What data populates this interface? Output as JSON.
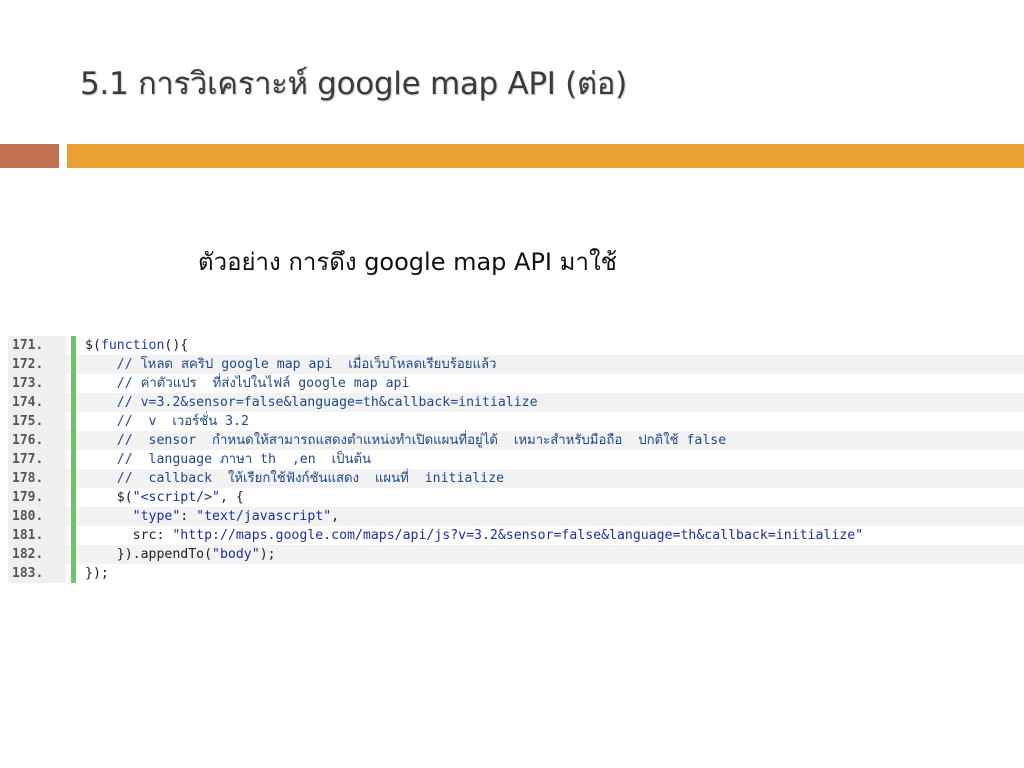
{
  "slide": {
    "title": "5.1 การวิเคราะห์ google map API (ต่อ)",
    "subtitle": "ตัวอย่าง การดึง google map API มาใช้"
  },
  "colors": {
    "title_text": "#3b3b3b",
    "band_left": "#c0704e",
    "band_right": "#eba032",
    "gutter_bar": "#6dc46d",
    "code_comment": "#1f4a8a",
    "code_keyword": "#1a3fa8",
    "code_string": "#1b2f9e"
  },
  "code": {
    "lines": [
      {
        "num": "171.",
        "parts": [
          {
            "t": "$(",
            "k": "plain"
          },
          {
            "t": "function",
            "k": "keyword"
          },
          {
            "t": "(){",
            "k": "plain"
          }
        ]
      },
      {
        "num": "172.",
        "parts": [
          {
            "t": "    // โหลด สคริป google map api  เมื่อเว็บโหลดเรียบร้อยแล้ว",
            "k": "comment"
          }
        ]
      },
      {
        "num": "173.",
        "parts": [
          {
            "t": "    // ค่าตัวแปร  ที่ส่งไปในไฟล์ google map api",
            "k": "comment"
          }
        ]
      },
      {
        "num": "174.",
        "parts": [
          {
            "t": "    // v=3.2&sensor=false&language=th&callback=initialize",
            "k": "comment"
          }
        ]
      },
      {
        "num": "175.",
        "parts": [
          {
            "t": "    //  v  เวอร์ชั่น 3.2",
            "k": "comment"
          }
        ]
      },
      {
        "num": "176.",
        "parts": [
          {
            "t": "    //  sensor  กำหนดให้สามารถแสดงตำแหน่งทำเปิดแผนที่อยู่ได้  เหมาะสำหรับมือถือ  ปกติใช้ false",
            "k": "comment"
          }
        ]
      },
      {
        "num": "177.",
        "parts": [
          {
            "t": "    //  language ภาษา th  ,en  เป็นต้น",
            "k": "comment"
          }
        ]
      },
      {
        "num": "178.",
        "parts": [
          {
            "t": "    //  callback  ให้เรียกใช้ฟังก์ชันแสดง  แผนที่  initialize",
            "k": "comment"
          }
        ]
      },
      {
        "num": "179.",
        "parts": [
          {
            "t": "    $(",
            "k": "plain"
          },
          {
            "t": "\"<script/>\"",
            "k": "string"
          },
          {
            "t": ", {",
            "k": "plain"
          }
        ]
      },
      {
        "num": "180.",
        "parts": [
          {
            "t": "      ",
            "k": "plain"
          },
          {
            "t": "\"type\"",
            "k": "string"
          },
          {
            "t": ": ",
            "k": "plain"
          },
          {
            "t": "\"text/javascript\"",
            "k": "string"
          },
          {
            "t": ",",
            "k": "plain"
          }
        ]
      },
      {
        "num": "181.",
        "parts": [
          {
            "t": "      src: ",
            "k": "plain"
          },
          {
            "t": "\"http://maps.google.com/maps/api/js?v=3.2&sensor=false&language=th&callback=initialize\"",
            "k": "string"
          }
        ]
      },
      {
        "num": "182.",
        "parts": [
          {
            "t": "    }).appendTo(",
            "k": "plain"
          },
          {
            "t": "\"body\"",
            "k": "string"
          },
          {
            "t": ");",
            "k": "plain"
          }
        ]
      },
      {
        "num": "183.",
        "parts": [
          {
            "t": "});",
            "k": "plain"
          }
        ]
      }
    ]
  }
}
